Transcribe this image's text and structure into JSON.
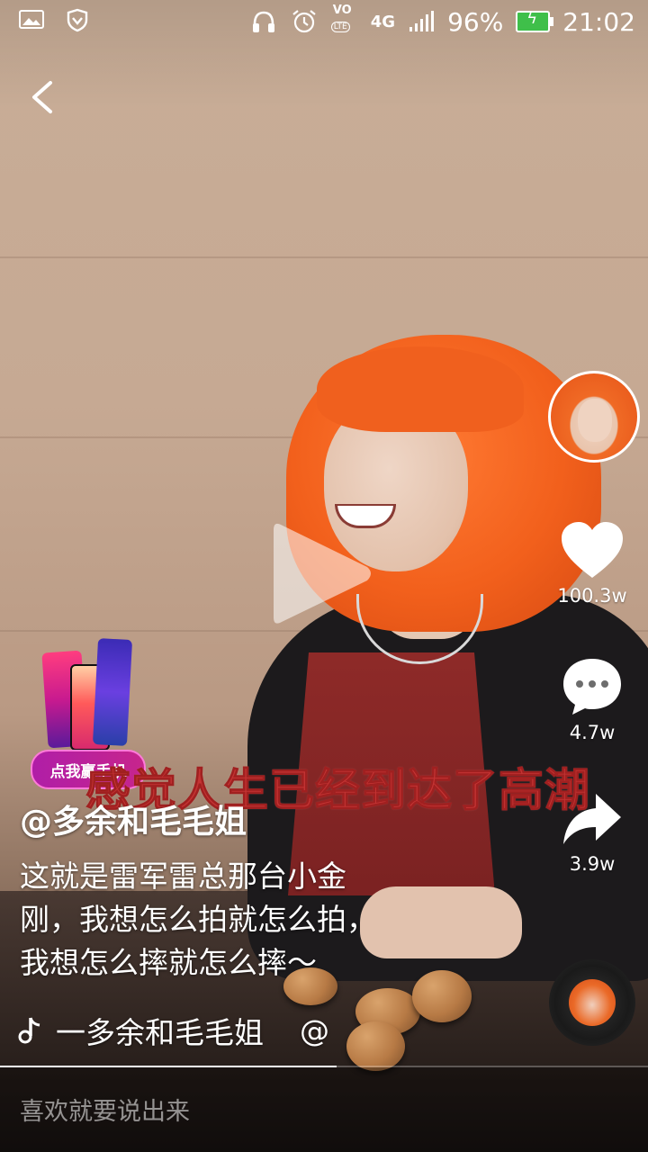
{
  "status_bar": {
    "icons_left": [
      "image-icon",
      "shield-icon"
    ],
    "icons_right": [
      "headset-icon",
      "alarm-icon",
      "volte-icon",
      "4g-icon",
      "signal-icon"
    ],
    "volte_label": "VO",
    "lte_label": "LTE",
    "network_label": "4G",
    "battery_percent": "96%",
    "time": "21:02",
    "battery_color": "#3fbf4a"
  },
  "video": {
    "subtitle": "感觉人生已经到达了高潮",
    "subtitle_color": "#c43333"
  },
  "ad": {
    "label": "点我赢手机"
  },
  "rail": {
    "like_count": "100.3w",
    "comment_count": "4.7w",
    "share_count": "3.9w"
  },
  "caption": {
    "username": "@多余和毛毛姐",
    "description_lines": [
      "这就是雷军雷总那台小金",
      "刚，我想怎么拍就怎么拍，",
      "我想怎么摔就怎么摔～"
    ],
    "music": "一多余和毛毛姐",
    "music_suffix": "@"
  },
  "playback": {
    "progress": 0.52
  },
  "comment": {
    "placeholder": "喜欢就要说出来"
  }
}
